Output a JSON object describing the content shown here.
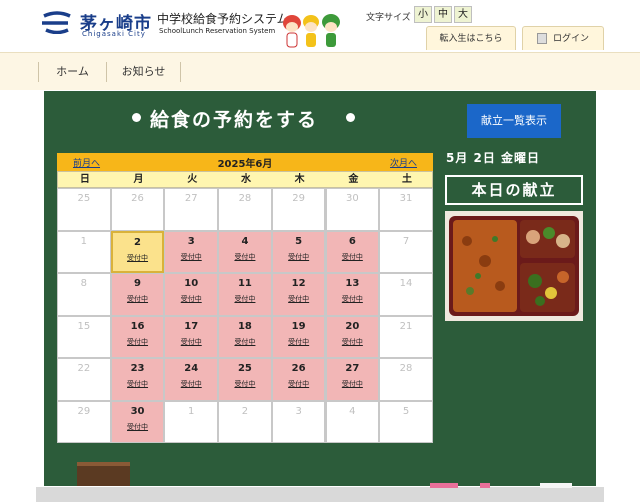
{
  "header": {
    "city_name": "茅ヶ崎市",
    "city_en": "Chigasaki City",
    "system_name": "中学校給食予約システム",
    "system_en": "SchoolLunch Reservation System",
    "font_size_label": "文字サイズ",
    "font_sizes": [
      "小",
      "中",
      "大"
    ],
    "transfer_label": "転入生はこちら",
    "login_label": "ログイン"
  },
  "nav": {
    "items": [
      "ホーム",
      "お知らせ"
    ]
  },
  "board": {
    "title": "給食の予約をする",
    "menu_list_button": "献立一覧表示",
    "side_date": "5月 2日 金曜日",
    "today_menu_label": "本日の献立"
  },
  "calendar": {
    "prev_label": "前月へ",
    "title": "2025年6月",
    "next_label": "次月へ",
    "weekdays": [
      "日",
      "月",
      "火",
      "水",
      "木",
      "金",
      "土"
    ],
    "status_label": "受付中",
    "weeks": [
      [
        {
          "d": "25",
          "s": "other"
        },
        {
          "d": "26",
          "s": "other"
        },
        {
          "d": "27",
          "s": "other"
        },
        {
          "d": "28",
          "s": "other"
        },
        {
          "d": "29",
          "s": "other"
        },
        {
          "d": "30",
          "s": "other"
        },
        {
          "d": "31",
          "s": "other"
        }
      ],
      [
        {
          "d": "1",
          "s": "other"
        },
        {
          "d": "2",
          "s": "today"
        },
        {
          "d": "3",
          "s": "avail"
        },
        {
          "d": "4",
          "s": "avail"
        },
        {
          "d": "5",
          "s": "avail"
        },
        {
          "d": "6",
          "s": "avail"
        },
        {
          "d": "7",
          "s": "other"
        }
      ],
      [
        {
          "d": "8",
          "s": "other"
        },
        {
          "d": "9",
          "s": "avail"
        },
        {
          "d": "10",
          "s": "avail"
        },
        {
          "d": "11",
          "s": "avail"
        },
        {
          "d": "12",
          "s": "avail"
        },
        {
          "d": "13",
          "s": "avail"
        },
        {
          "d": "14",
          "s": "other"
        }
      ],
      [
        {
          "d": "15",
          "s": "other"
        },
        {
          "d": "16",
          "s": "avail"
        },
        {
          "d": "17",
          "s": "avail"
        },
        {
          "d": "18",
          "s": "avail"
        },
        {
          "d": "19",
          "s": "avail"
        },
        {
          "d": "20",
          "s": "avail"
        },
        {
          "d": "21",
          "s": "other"
        }
      ],
      [
        {
          "d": "22",
          "s": "other"
        },
        {
          "d": "23",
          "s": "avail"
        },
        {
          "d": "24",
          "s": "avail"
        },
        {
          "d": "25",
          "s": "avail"
        },
        {
          "d": "26",
          "s": "avail"
        },
        {
          "d": "27",
          "s": "avail"
        },
        {
          "d": "28",
          "s": "other"
        }
      ],
      [
        {
          "d": "29",
          "s": "other"
        },
        {
          "d": "30",
          "s": "avail"
        },
        {
          "d": "1",
          "s": "other"
        },
        {
          "d": "2",
          "s": "other"
        },
        {
          "d": "3",
          "s": "other"
        },
        {
          "d": "4",
          "s": "other"
        },
        {
          "d": "5",
          "s": "other"
        }
      ]
    ]
  },
  "colors": {
    "board_green": "#2c5c3a",
    "available_pink": "#f2b6b6",
    "today_yellow": "#fbe28c",
    "header_orange": "#f7b619",
    "button_blue": "#1b67c9",
    "brand_navy": "#1a3e8a"
  }
}
